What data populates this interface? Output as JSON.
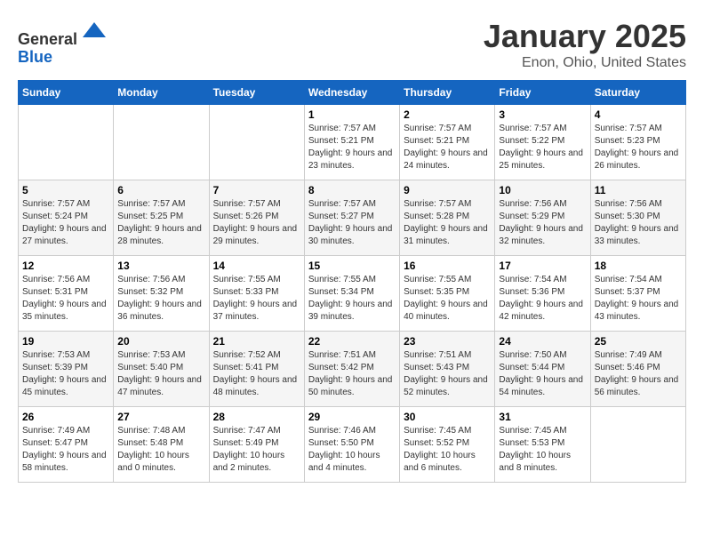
{
  "header": {
    "logo_line1": "General",
    "logo_line2": "Blue",
    "title": "January 2025",
    "subtitle": "Enon, Ohio, United States"
  },
  "days_of_week": [
    "Sunday",
    "Monday",
    "Tuesday",
    "Wednesday",
    "Thursday",
    "Friday",
    "Saturday"
  ],
  "weeks": [
    [
      {
        "day": "",
        "sunrise": "",
        "sunset": "",
        "daylight": ""
      },
      {
        "day": "",
        "sunrise": "",
        "sunset": "",
        "daylight": ""
      },
      {
        "day": "",
        "sunrise": "",
        "sunset": "",
        "daylight": ""
      },
      {
        "day": "1",
        "sunrise": "Sunrise: 7:57 AM",
        "sunset": "Sunset: 5:21 PM",
        "daylight": "Daylight: 9 hours and 23 minutes."
      },
      {
        "day": "2",
        "sunrise": "Sunrise: 7:57 AM",
        "sunset": "Sunset: 5:21 PM",
        "daylight": "Daylight: 9 hours and 24 minutes."
      },
      {
        "day": "3",
        "sunrise": "Sunrise: 7:57 AM",
        "sunset": "Sunset: 5:22 PM",
        "daylight": "Daylight: 9 hours and 25 minutes."
      },
      {
        "day": "4",
        "sunrise": "Sunrise: 7:57 AM",
        "sunset": "Sunset: 5:23 PM",
        "daylight": "Daylight: 9 hours and 26 minutes."
      }
    ],
    [
      {
        "day": "5",
        "sunrise": "Sunrise: 7:57 AM",
        "sunset": "Sunset: 5:24 PM",
        "daylight": "Daylight: 9 hours and 27 minutes."
      },
      {
        "day": "6",
        "sunrise": "Sunrise: 7:57 AM",
        "sunset": "Sunset: 5:25 PM",
        "daylight": "Daylight: 9 hours and 28 minutes."
      },
      {
        "day": "7",
        "sunrise": "Sunrise: 7:57 AM",
        "sunset": "Sunset: 5:26 PM",
        "daylight": "Daylight: 9 hours and 29 minutes."
      },
      {
        "day": "8",
        "sunrise": "Sunrise: 7:57 AM",
        "sunset": "Sunset: 5:27 PM",
        "daylight": "Daylight: 9 hours and 30 minutes."
      },
      {
        "day": "9",
        "sunrise": "Sunrise: 7:57 AM",
        "sunset": "Sunset: 5:28 PM",
        "daylight": "Daylight: 9 hours and 31 minutes."
      },
      {
        "day": "10",
        "sunrise": "Sunrise: 7:56 AM",
        "sunset": "Sunset: 5:29 PM",
        "daylight": "Daylight: 9 hours and 32 minutes."
      },
      {
        "day": "11",
        "sunrise": "Sunrise: 7:56 AM",
        "sunset": "Sunset: 5:30 PM",
        "daylight": "Daylight: 9 hours and 33 minutes."
      }
    ],
    [
      {
        "day": "12",
        "sunrise": "Sunrise: 7:56 AM",
        "sunset": "Sunset: 5:31 PM",
        "daylight": "Daylight: 9 hours and 35 minutes."
      },
      {
        "day": "13",
        "sunrise": "Sunrise: 7:56 AM",
        "sunset": "Sunset: 5:32 PM",
        "daylight": "Daylight: 9 hours and 36 minutes."
      },
      {
        "day": "14",
        "sunrise": "Sunrise: 7:55 AM",
        "sunset": "Sunset: 5:33 PM",
        "daylight": "Daylight: 9 hours and 37 minutes."
      },
      {
        "day": "15",
        "sunrise": "Sunrise: 7:55 AM",
        "sunset": "Sunset: 5:34 PM",
        "daylight": "Daylight: 9 hours and 39 minutes."
      },
      {
        "day": "16",
        "sunrise": "Sunrise: 7:55 AM",
        "sunset": "Sunset: 5:35 PM",
        "daylight": "Daylight: 9 hours and 40 minutes."
      },
      {
        "day": "17",
        "sunrise": "Sunrise: 7:54 AM",
        "sunset": "Sunset: 5:36 PM",
        "daylight": "Daylight: 9 hours and 42 minutes."
      },
      {
        "day": "18",
        "sunrise": "Sunrise: 7:54 AM",
        "sunset": "Sunset: 5:37 PM",
        "daylight": "Daylight: 9 hours and 43 minutes."
      }
    ],
    [
      {
        "day": "19",
        "sunrise": "Sunrise: 7:53 AM",
        "sunset": "Sunset: 5:39 PM",
        "daylight": "Daylight: 9 hours and 45 minutes."
      },
      {
        "day": "20",
        "sunrise": "Sunrise: 7:53 AM",
        "sunset": "Sunset: 5:40 PM",
        "daylight": "Daylight: 9 hours and 47 minutes."
      },
      {
        "day": "21",
        "sunrise": "Sunrise: 7:52 AM",
        "sunset": "Sunset: 5:41 PM",
        "daylight": "Daylight: 9 hours and 48 minutes."
      },
      {
        "day": "22",
        "sunrise": "Sunrise: 7:51 AM",
        "sunset": "Sunset: 5:42 PM",
        "daylight": "Daylight: 9 hours and 50 minutes."
      },
      {
        "day": "23",
        "sunrise": "Sunrise: 7:51 AM",
        "sunset": "Sunset: 5:43 PM",
        "daylight": "Daylight: 9 hours and 52 minutes."
      },
      {
        "day": "24",
        "sunrise": "Sunrise: 7:50 AM",
        "sunset": "Sunset: 5:44 PM",
        "daylight": "Daylight: 9 hours and 54 minutes."
      },
      {
        "day": "25",
        "sunrise": "Sunrise: 7:49 AM",
        "sunset": "Sunset: 5:46 PM",
        "daylight": "Daylight: 9 hours and 56 minutes."
      }
    ],
    [
      {
        "day": "26",
        "sunrise": "Sunrise: 7:49 AM",
        "sunset": "Sunset: 5:47 PM",
        "daylight": "Daylight: 9 hours and 58 minutes."
      },
      {
        "day": "27",
        "sunrise": "Sunrise: 7:48 AM",
        "sunset": "Sunset: 5:48 PM",
        "daylight": "Daylight: 10 hours and 0 minutes."
      },
      {
        "day": "28",
        "sunrise": "Sunrise: 7:47 AM",
        "sunset": "Sunset: 5:49 PM",
        "daylight": "Daylight: 10 hours and 2 minutes."
      },
      {
        "day": "29",
        "sunrise": "Sunrise: 7:46 AM",
        "sunset": "Sunset: 5:50 PM",
        "daylight": "Daylight: 10 hours and 4 minutes."
      },
      {
        "day": "30",
        "sunrise": "Sunrise: 7:45 AM",
        "sunset": "Sunset: 5:52 PM",
        "daylight": "Daylight: 10 hours and 6 minutes."
      },
      {
        "day": "31",
        "sunrise": "Sunrise: 7:45 AM",
        "sunset": "Sunset: 5:53 PM",
        "daylight": "Daylight: 10 hours and 8 minutes."
      },
      {
        "day": "",
        "sunrise": "",
        "sunset": "",
        "daylight": ""
      }
    ]
  ]
}
